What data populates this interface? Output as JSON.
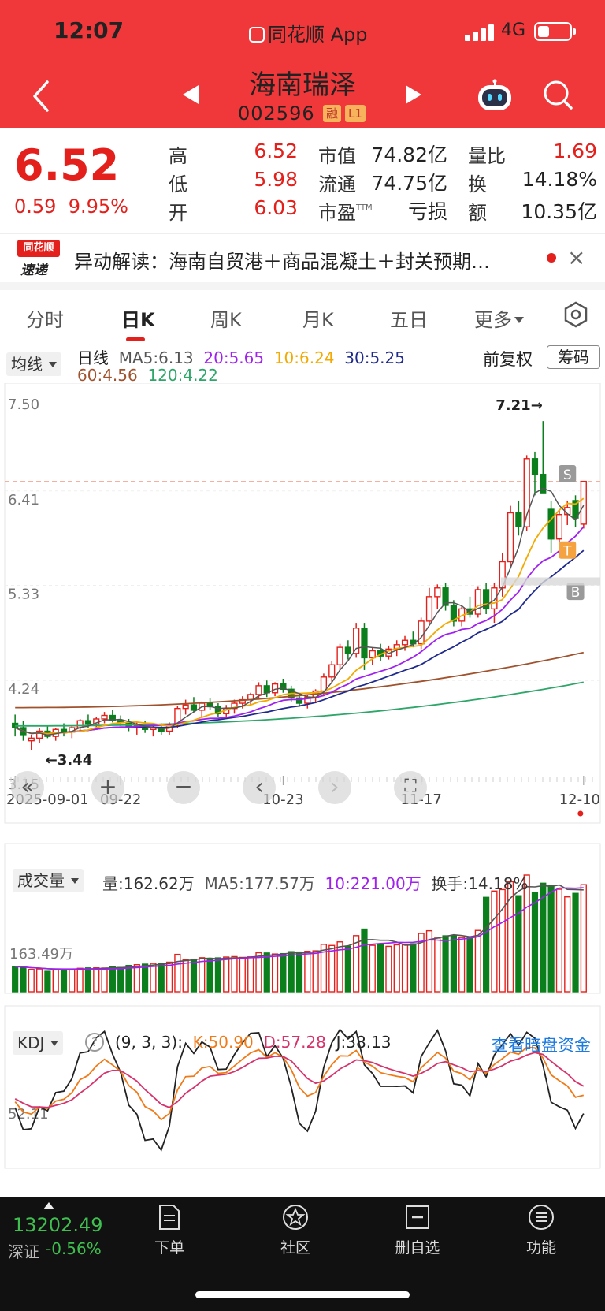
{
  "status_bar": {
    "time": "12:07",
    "app_label": "同花顺 App",
    "network": "4G"
  },
  "header": {
    "stock_name": "海南瑞泽",
    "stock_code": "002596",
    "tag_margin": "融",
    "tag_level": "L1"
  },
  "quote": {
    "price": "6.52",
    "change": "0.59",
    "change_pct": "9.95%",
    "high_label": "高",
    "high": "6.52",
    "low_label": "低",
    "low": "5.98",
    "open_label": "开",
    "open": "6.03",
    "mktcap_label": "市值",
    "mktcap": "74.82亿",
    "float_label": "流通",
    "float": "74.75亿",
    "pe_label": "市盈",
    "pe_sup": "TTM",
    "pe": "亏损",
    "volratio_label": "量比",
    "volratio": "1.69",
    "turnover_label": "换",
    "turnover": "14.18%",
    "amount_label": "额",
    "amount": "10.35亿"
  },
  "news": {
    "logo_top": "同花顺",
    "logo_bottom": "速递",
    "text": "异动解读：海南自贸港＋商品混凝土＋封关预期…"
  },
  "tabs": [
    "分时",
    "日K",
    "周K",
    "月K",
    "五日",
    "更多"
  ],
  "active_tab": "日K",
  "kline_header": {
    "indicator": "均线",
    "period": "日线",
    "ma5": "MA5:6.13",
    "ma20": "20:5.65",
    "ma10": "10:6.24",
    "ma30": "30:5.25",
    "ma60": "60:4.56",
    "ma120": "120:4.22",
    "adjust": "前复权",
    "chip": "筹码"
  },
  "kline_axis": {
    "y_labels": [
      "7.50",
      "6.41",
      "5.33",
      "4.24",
      "3.15"
    ],
    "x_labels": [
      "2025-09-01",
      "09-22",
      "10-23",
      "11-17",
      "12-10"
    ],
    "max_note": "7.21→",
    "min_note": "←3.44",
    "markers": [
      "S",
      "T",
      "B"
    ]
  },
  "volume_header": {
    "indicator": "成交量",
    "vol": "量:162.62万",
    "ma5": "MA5:177.57万",
    "ma10": "10:221.00万",
    "turnover": "换手:14.18%",
    "y_label": "163.49万"
  },
  "kdj_header": {
    "indicator": "KDJ",
    "help": "?",
    "params": "(9, 3, 3):",
    "k": "K:50.90",
    "d": "D:57.28",
    "j": "J:38.13",
    "link": "查看暗盘资金",
    "y_label": "52.11"
  },
  "bottom_nav": {
    "index_value": "13202.49",
    "index_name": "深证",
    "index_change": "-0.56%",
    "items": [
      "下单",
      "社区",
      "删自选",
      "功能"
    ]
  },
  "colors": {
    "brand_red": "#f0383b",
    "up_red": "#e3201b",
    "down_green": "#0a7f1c",
    "ma5": "#555555",
    "ma10": "#f2a900",
    "ma20": "#a020f0",
    "ma30": "#1f2a8c",
    "ma60": "#a0522d",
    "ma120": "#2ea66a",
    "link_blue": "#1e7be0"
  },
  "chart_data": [
    {
      "type": "candlestick",
      "title": "日线",
      "ylim": [
        3.15,
        7.5
      ],
      "x_ticks": [
        "2025-09-01",
        "09-22",
        "10-23",
        "11-17",
        "12-10"
      ],
      "max_price": 7.21,
      "min_price": 3.44,
      "last_close": 6.52,
      "candles": [
        {
          "o": 3.75,
          "h": 3.85,
          "l": 3.6,
          "c": 3.7
        },
        {
          "o": 3.7,
          "h": 3.78,
          "l": 3.55,
          "c": 3.62
        },
        {
          "o": 3.55,
          "h": 3.62,
          "l": 3.44,
          "c": 3.58
        },
        {
          "o": 3.58,
          "h": 3.7,
          "l": 3.52,
          "c": 3.66
        },
        {
          "o": 3.66,
          "h": 3.72,
          "l": 3.58,
          "c": 3.6
        },
        {
          "o": 3.6,
          "h": 3.7,
          "l": 3.55,
          "c": 3.68
        },
        {
          "o": 3.68,
          "h": 3.75,
          "l": 3.6,
          "c": 3.65
        },
        {
          "o": 3.65,
          "h": 3.72,
          "l": 3.58,
          "c": 3.7
        },
        {
          "o": 3.7,
          "h": 3.8,
          "l": 3.65,
          "c": 3.78
        },
        {
          "o": 3.78,
          "h": 3.85,
          "l": 3.7,
          "c": 3.74
        },
        {
          "o": 3.74,
          "h": 3.82,
          "l": 3.68,
          "c": 3.8
        },
        {
          "o": 3.8,
          "h": 3.88,
          "l": 3.75,
          "c": 3.84
        },
        {
          "o": 3.84,
          "h": 3.9,
          "l": 3.76,
          "c": 3.78
        },
        {
          "o": 3.78,
          "h": 3.84,
          "l": 3.72,
          "c": 3.76
        },
        {
          "o": 3.76,
          "h": 3.8,
          "l": 3.66,
          "c": 3.7
        },
        {
          "o": 3.7,
          "h": 3.76,
          "l": 3.62,
          "c": 3.72
        },
        {
          "o": 3.72,
          "h": 3.78,
          "l": 3.64,
          "c": 3.68
        },
        {
          "o": 3.68,
          "h": 3.74,
          "l": 3.6,
          "c": 3.7
        },
        {
          "o": 3.7,
          "h": 3.75,
          "l": 3.62,
          "c": 3.66
        },
        {
          "o": 3.66,
          "h": 3.76,
          "l": 3.62,
          "c": 3.74
        },
        {
          "o": 3.74,
          "h": 3.95,
          "l": 3.7,
          "c": 3.92
        },
        {
          "o": 3.92,
          "h": 4.02,
          "l": 3.85,
          "c": 3.96
        },
        {
          "o": 3.96,
          "h": 4.05,
          "l": 3.88,
          "c": 3.9
        },
        {
          "o": 3.9,
          "h": 4.0,
          "l": 3.82,
          "c": 3.98
        },
        {
          "o": 3.98,
          "h": 4.04,
          "l": 3.9,
          "c": 3.94
        },
        {
          "o": 3.94,
          "h": 3.98,
          "l": 3.82,
          "c": 3.86
        },
        {
          "o": 3.86,
          "h": 3.96,
          "l": 3.8,
          "c": 3.92
        },
        {
          "o": 3.92,
          "h": 4.02,
          "l": 3.86,
          "c": 3.98
        },
        {
          "o": 3.98,
          "h": 4.06,
          "l": 3.92,
          "c": 4.02
        },
        {
          "o": 4.02,
          "h": 4.1,
          "l": 3.96,
          "c": 4.08
        },
        {
          "o": 4.08,
          "h": 4.22,
          "l": 4.02,
          "c": 4.18
        },
        {
          "o": 4.18,
          "h": 4.24,
          "l": 4.05,
          "c": 4.1
        },
        {
          "o": 4.1,
          "h": 4.22,
          "l": 4.06,
          "c": 4.2
        },
        {
          "o": 4.2,
          "h": 4.26,
          "l": 4.1,
          "c": 4.14
        },
        {
          "o": 4.14,
          "h": 4.18,
          "l": 4.0,
          "c": 4.04
        },
        {
          "o": 4.04,
          "h": 4.1,
          "l": 3.94,
          "c": 3.98
        },
        {
          "o": 3.98,
          "h": 4.08,
          "l": 3.92,
          "c": 4.05
        },
        {
          "o": 4.05,
          "h": 4.14,
          "l": 3.98,
          "c": 4.12
        },
        {
          "o": 4.12,
          "h": 4.32,
          "l": 4.06,
          "c": 4.28
        },
        {
          "o": 4.28,
          "h": 4.46,
          "l": 4.22,
          "c": 4.42
        },
        {
          "o": 4.42,
          "h": 4.66,
          "l": 4.36,
          "c": 4.62
        },
        {
          "o": 4.62,
          "h": 4.7,
          "l": 4.48,
          "c": 4.55
        },
        {
          "o": 4.55,
          "h": 4.9,
          "l": 4.5,
          "c": 4.84
        },
        {
          "o": 4.84,
          "h": 4.9,
          "l": 4.36,
          "c": 4.5
        },
        {
          "o": 4.5,
          "h": 4.62,
          "l": 4.42,
          "c": 4.58
        },
        {
          "o": 4.58,
          "h": 4.66,
          "l": 4.46,
          "c": 4.52
        },
        {
          "o": 4.52,
          "h": 4.64,
          "l": 4.48,
          "c": 4.6
        },
        {
          "o": 4.6,
          "h": 4.7,
          "l": 4.52,
          "c": 4.65
        },
        {
          "o": 4.65,
          "h": 4.75,
          "l": 4.58,
          "c": 4.7
        },
        {
          "o": 4.7,
          "h": 4.8,
          "l": 4.62,
          "c": 4.66
        },
        {
          "o": 4.66,
          "h": 4.96,
          "l": 4.6,
          "c": 4.92
        },
        {
          "o": 4.92,
          "h": 5.3,
          "l": 4.88,
          "c": 5.2
        },
        {
          "o": 5.2,
          "h": 5.34,
          "l": 5.06,
          "c": 5.3
        },
        {
          "o": 5.3,
          "h": 5.36,
          "l": 5.04,
          "c": 5.1
        },
        {
          "o": 5.1,
          "h": 5.16,
          "l": 4.86,
          "c": 4.92
        },
        {
          "o": 4.92,
          "h": 5.1,
          "l": 4.86,
          "c": 5.06
        },
        {
          "o": 5.06,
          "h": 5.2,
          "l": 4.96,
          "c": 5.0
        },
        {
          "o": 5.0,
          "h": 5.32,
          "l": 4.96,
          "c": 5.28
        },
        {
          "o": 5.28,
          "h": 5.36,
          "l": 5.0,
          "c": 5.06
        },
        {
          "o": 5.06,
          "h": 5.36,
          "l": 4.9,
          "c": 5.3
        },
        {
          "o": 5.3,
          "h": 5.7,
          "l": 5.2,
          "c": 5.6
        },
        {
          "o": 5.6,
          "h": 6.24,
          "l": 5.55,
          "c": 6.16
        },
        {
          "o": 6.16,
          "h": 6.3,
          "l": 5.9,
          "c": 6.0
        },
        {
          "o": 6.0,
          "h": 6.82,
          "l": 5.95,
          "c": 6.78
        },
        {
          "o": 6.78,
          "h": 6.86,
          "l": 6.36,
          "c": 6.6
        },
        {
          "o": 6.6,
          "h": 7.21,
          "l": 6.5,
          "c": 6.38
        },
        {
          "o": 6.2,
          "h": 6.3,
          "l": 5.7,
          "c": 5.86
        },
        {
          "o": 5.86,
          "h": 6.2,
          "l": 5.74,
          "c": 6.14
        },
        {
          "o": 6.14,
          "h": 6.3,
          "l": 6.02,
          "c": 6.22
        },
        {
          "o": 6.3,
          "h": 6.36,
          "l": 6.0,
          "c": 6.1
        },
        {
          "o": 6.03,
          "h": 6.52,
          "l": 5.98,
          "c": 6.52
        }
      ],
      "ma": {
        "MA5": 6.13,
        "MA10": 6.24,
        "MA20": 5.65,
        "MA30": 5.25,
        "MA60": 4.56,
        "MA120": 4.22
      }
    },
    {
      "type": "bar",
      "title": "成交量",
      "unit": "万",
      "last_volume": 162.62,
      "ma5": 177.57,
      "ma10": 221.0
    },
    {
      "type": "line",
      "title": "KDJ",
      "params": [
        9,
        3,
        3
      ],
      "series": [
        {
          "name": "K",
          "last": 50.9
        },
        {
          "name": "D",
          "last": 57.28
        },
        {
          "name": "J",
          "last": 38.13
        }
      ]
    }
  ]
}
